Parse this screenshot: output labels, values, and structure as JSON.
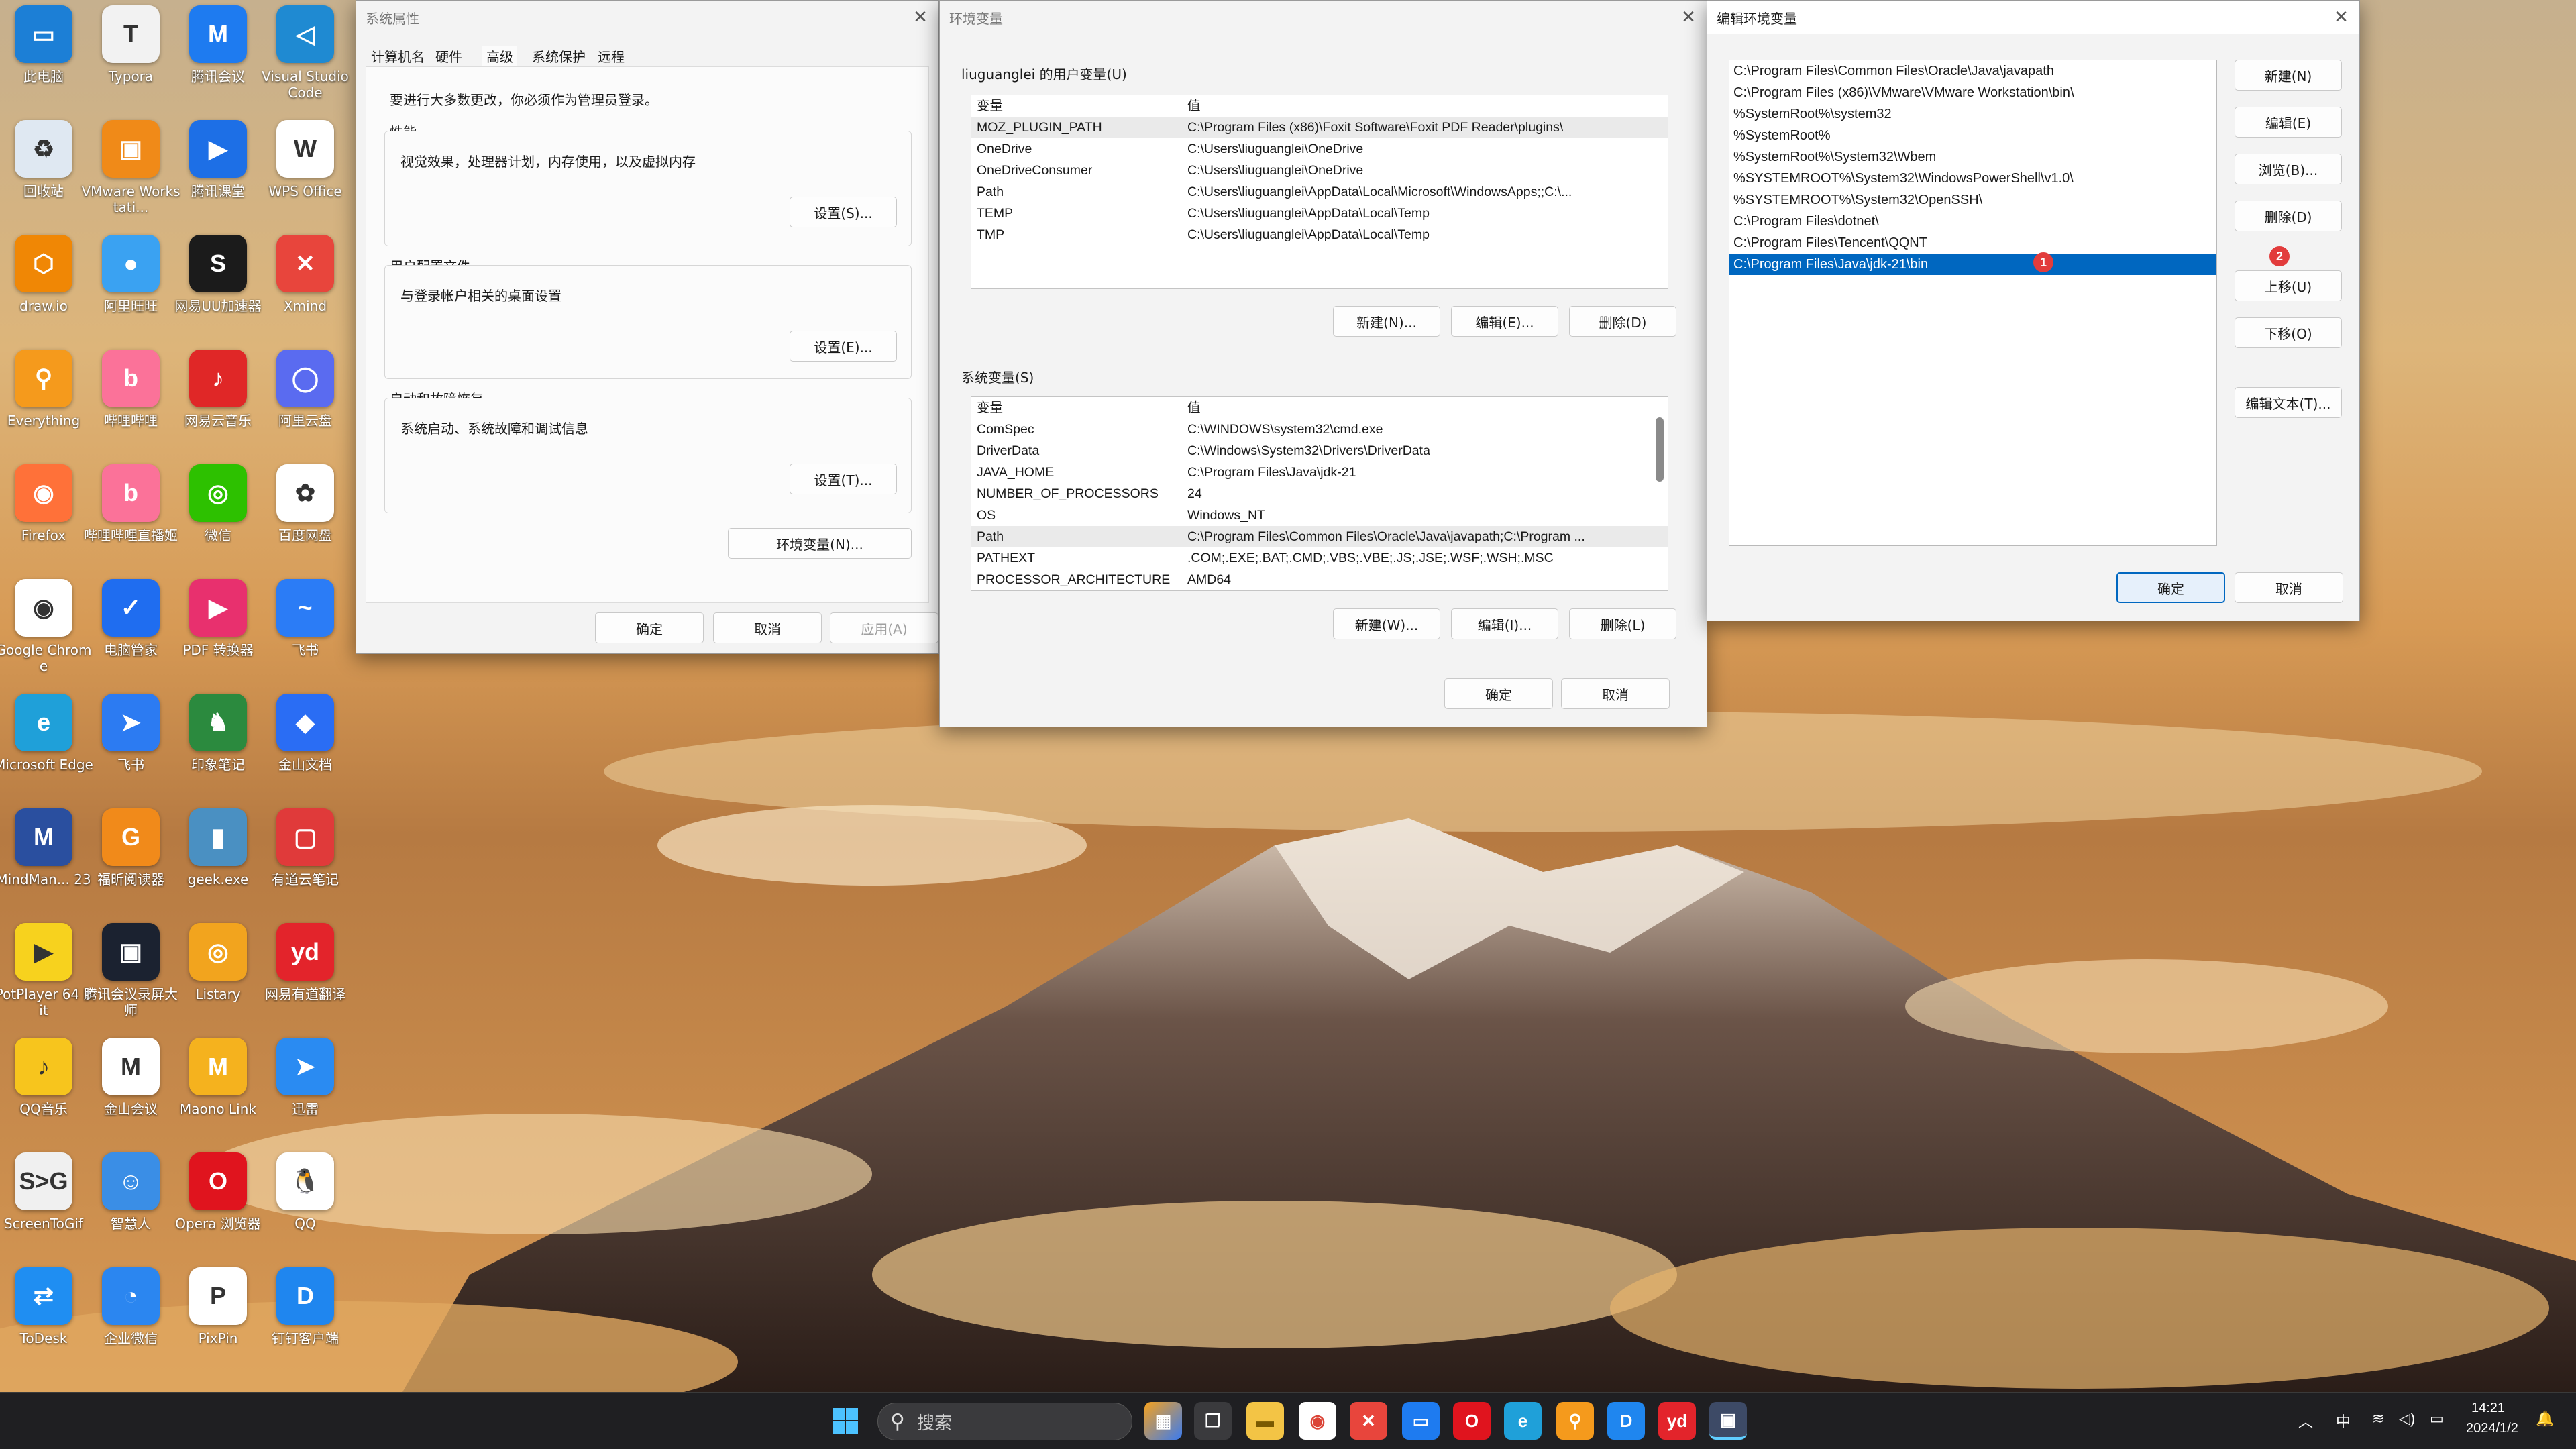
{
  "desktop_icons": [
    {
      "label": "此电脑",
      "icon": "computer-icon",
      "color": "#1c7fd6",
      "glyph": "▭"
    },
    {
      "label": "Typora",
      "icon": "typora-icon",
      "color": "#f2f2f2",
      "glyph": "T"
    },
    {
      "label": "腾讯会议",
      "icon": "tencent-meeting-icon",
      "color": "#1e7bf0",
      "glyph": "M"
    },
    {
      "label": "Visual Studio Code",
      "icon": "vscode-icon",
      "color": "#1f8ad2",
      "glyph": "◁"
    },
    {
      "label": "回收站",
      "icon": "recycle-bin-icon",
      "color": "#dfe8f2",
      "glyph": "♻"
    },
    {
      "label": "VMware Workstati...",
      "icon": "vmware-icon",
      "color": "#f08a18",
      "glyph": "▣"
    },
    {
      "label": "腾讯课堂",
      "icon": "tencent-classroom-icon",
      "color": "#1d6fe6",
      "glyph": "▶"
    },
    {
      "label": "WPS Office",
      "icon": "wps-icon",
      "color": "#ffffff",
      "glyph": "W"
    },
    {
      "label": "draw.io",
      "icon": "drawio-icon",
      "color": "#f08705",
      "glyph": "⬡"
    },
    {
      "label": "阿里旺旺",
      "icon": "aliwangwang-icon",
      "color": "#3aa2f2",
      "glyph": "●"
    },
    {
      "label": "网易UU加速器",
      "icon": "uu-accelerator-icon",
      "color": "#1b1b1b",
      "glyph": "S"
    },
    {
      "label": "Xmind",
      "icon": "xmind-icon",
      "color": "#e8453c",
      "glyph": "✕"
    },
    {
      "label": "Everything",
      "icon": "everything-icon",
      "color": "#f59a1c",
      "glyph": "⚲"
    },
    {
      "label": "哔哩哔哩",
      "icon": "bilibili-icon",
      "color": "#fb7299",
      "glyph": "b"
    },
    {
      "label": "网易云音乐",
      "icon": "netease-music-icon",
      "color": "#e02727",
      "glyph": "♪"
    },
    {
      "label": "阿里云盘",
      "icon": "aliyun-drive-icon",
      "color": "#5a6bf0",
      "glyph": "◯"
    },
    {
      "label": "Firefox",
      "icon": "firefox-icon",
      "color": "#ff7139",
      "glyph": "◉"
    },
    {
      "label": "哔哩哔哩直播姬",
      "icon": "bilibili-live-icon",
      "color": "#fb7299",
      "glyph": "b"
    },
    {
      "label": "微信",
      "icon": "wechat-icon",
      "color": "#2dc100",
      "glyph": "◎"
    },
    {
      "label": "百度网盘",
      "icon": "baidu-netdisk-icon",
      "color": "#ffffff",
      "glyph": "✿"
    },
    {
      "label": "Google Chrome",
      "icon": "chrome-icon",
      "color": "#ffffff",
      "glyph": "◉"
    },
    {
      "label": "电脑管家",
      "icon": "pc-manager-icon",
      "color": "#1f6df0",
      "glyph": "✓"
    },
    {
      "label": "PDF 转换器",
      "icon": "pdf-converter-icon",
      "color": "#e8306e",
      "glyph": "▶"
    },
    {
      "label": "飞书",
      "icon": "feishu-icon",
      "color": "#2b7cf6",
      "glyph": "~"
    },
    {
      "label": "Microsoft Edge",
      "icon": "edge-icon",
      "color": "#1fa0d9",
      "glyph": "e"
    },
    {
      "label": "飞书",
      "icon": "feishu-bird-icon",
      "color": "#2c7bf2",
      "glyph": "➤"
    },
    {
      "label": "印象笔记",
      "icon": "evernote-icon",
      "color": "#2b8a3e",
      "glyph": "♞"
    },
    {
      "label": "金山文档",
      "icon": "kdocs-icon",
      "color": "#2a6df4",
      "glyph": "◆"
    },
    {
      "label": "MindMan... 23",
      "icon": "mindmanager-icon",
      "color": "#2a4f9f",
      "glyph": "M"
    },
    {
      "label": "福昕阅读器",
      "icon": "foxit-icon",
      "color": "#f18a1a",
      "glyph": "G"
    },
    {
      "label": "geek.exe",
      "icon": "geek-uninstaller-icon",
      "color": "#4a90c2",
      "glyph": "▮"
    },
    {
      "label": "有道云笔记",
      "icon": "youdao-note-icon",
      "color": "#e03a3a",
      "glyph": "▢"
    },
    {
      "label": "PotPlayer 64 bit",
      "icon": "potplayer-icon",
      "color": "#f7d21e",
      "glyph": "▶"
    },
    {
      "label": "腾讯会议录屏大师",
      "icon": "screen-recorder-icon",
      "color": "#1b2230",
      "glyph": "▣"
    },
    {
      "label": "Listary",
      "icon": "listary-icon",
      "color": "#f2a41e",
      "glyph": "◎"
    },
    {
      "label": "网易有道翻译",
      "icon": "youdao-translate-icon",
      "color": "#e3242b",
      "glyph": "yd"
    },
    {
      "label": "QQ音乐",
      "icon": "qq-music-icon",
      "color": "#f7c51d",
      "glyph": "♪"
    },
    {
      "label": "金山会议",
      "icon": "kmeeting-icon",
      "color": "#ffffff",
      "glyph": "M"
    },
    {
      "label": "Maono Link",
      "icon": "maono-link-icon",
      "color": "#f5b21e",
      "glyph": "M"
    },
    {
      "label": "迅雷",
      "icon": "xunlei-icon",
      "color": "#2a8bf2",
      "glyph": "➤"
    },
    {
      "label": "ScreenToGif",
      "icon": "screentogif-icon",
      "color": "#f0f0f0",
      "glyph": "S>G"
    },
    {
      "label": "智慧人",
      "icon": "qq-robot-icon",
      "color": "#3a8ee6",
      "glyph": "☺"
    },
    {
      "label": "Opera 浏览器",
      "icon": "opera-icon",
      "color": "#e0141e",
      "glyph": "O"
    },
    {
      "label": "QQ",
      "icon": "qq-icon",
      "color": "#ffffff",
      "glyph": "🐧"
    },
    {
      "label": "ToDesk",
      "icon": "todesk-icon",
      "color": "#1f8ef2",
      "glyph": "⇄"
    },
    {
      "label": "企业微信",
      "icon": "wecom-icon",
      "color": "#2b86f0",
      "glyph": "◔"
    },
    {
      "label": "PixPin",
      "icon": "pixpin-icon",
      "color": "#ffffff",
      "glyph": "P"
    },
    {
      "label": "钉钉客户端",
      "icon": "dingtalk-doc-icon",
      "color": "#1f86ef",
      "glyph": "D"
    }
  ],
  "sysprop": {
    "title": "系统属性",
    "tabs": [
      "计算机名",
      "硬件",
      "高级",
      "系统保护",
      "远程"
    ],
    "notice": "要进行大多数更改，你必须作为管理员登录。",
    "perf_title": "性能",
    "perf_desc": "视觉效果，处理器计划，内存使用，以及虚拟内存",
    "perf_btn": "设置(S)...",
    "profile_title": "用户配置文件",
    "profile_desc": "与登录帐户相关的桌面设置",
    "profile_btn": "设置(E)...",
    "startup_title": "启动和故障恢复",
    "startup_desc": "系统启动、系统故障和调试信息",
    "startup_btn": "设置(T)...",
    "env_btn": "环境变量(N)...",
    "ok": "确定",
    "cancel": "取消",
    "apply": "应用(A)"
  },
  "envvars": {
    "title": "环境变量",
    "user_title": "liuguanglei 的用户变量(U)",
    "col_var": "变量",
    "col_val": "值",
    "user_rows": [
      {
        "name": "MOZ_PLUGIN_PATH",
        "value": "C:\\Program Files (x86)\\Foxit Software\\Foxit PDF Reader\\plugins\\"
      },
      {
        "name": "OneDrive",
        "value": "C:\\Users\\liuguanglei\\OneDrive"
      },
      {
        "name": "OneDriveConsumer",
        "value": "C:\\Users\\liuguanglei\\OneDrive"
      },
      {
        "name": "Path",
        "value": "C:\\Users\\liuguanglei\\AppData\\Local\\Microsoft\\WindowsApps;;C:\\..."
      },
      {
        "name": "TEMP",
        "value": "C:\\Users\\liuguanglei\\AppData\\Local\\Temp"
      },
      {
        "name": "TMP",
        "value": "C:\\Users\\liuguanglei\\AppData\\Local\\Temp"
      }
    ],
    "user_new": "新建(N)...",
    "user_edit": "编辑(E)...",
    "user_delete": "删除(D)",
    "sys_title": "系统变量(S)",
    "sys_rows": [
      {
        "name": "ComSpec",
        "value": "C:\\WINDOWS\\system32\\cmd.exe"
      },
      {
        "name": "DriverData",
        "value": "C:\\Windows\\System32\\Drivers\\DriverData"
      },
      {
        "name": "JAVA_HOME",
        "value": "C:\\Program Files\\Java\\jdk-21"
      },
      {
        "name": "NUMBER_OF_PROCESSORS",
        "value": "24"
      },
      {
        "name": "OS",
        "value": "Windows_NT"
      },
      {
        "name": "Path",
        "value": "C:\\Program Files\\Common Files\\Oracle\\Java\\javapath;C:\\Program ..."
      },
      {
        "name": "PATHEXT",
        "value": ".COM;.EXE;.BAT;.CMD;.VBS;.VBE;.JS;.JSE;.WSF;.WSH;.MSC"
      },
      {
        "name": "PROCESSOR_ARCHITECTURE",
        "value": "AMD64"
      }
    ],
    "sys_new": "新建(W)...",
    "sys_edit": "编辑(I)...",
    "sys_delete": "删除(L)",
    "ok": "确定",
    "cancel": "取消"
  },
  "editenv": {
    "title": "编辑环境变量",
    "paths": [
      "C:\\Program Files\\Common Files\\Oracle\\Java\\javapath",
      "C:\\Program Files (x86)\\VMware\\VMware Workstation\\bin\\",
      "%SystemRoot%\\system32",
      "%SystemRoot%",
      "%SystemRoot%\\System32\\Wbem",
      "%SYSTEMROOT%\\System32\\WindowsPowerShell\\v1.0\\",
      "%SYSTEMROOT%\\System32\\OpenSSH\\",
      "C:\\Program Files\\dotnet\\",
      "C:\\Program Files\\Tencent\\QQNT",
      "C:\\Program Files\\Java\\jdk-21\\bin"
    ],
    "badge1": "1",
    "badge2": "2",
    "new_btn": "新建(N)",
    "edit_btn": "编辑(E)",
    "browse_btn": "浏览(B)...",
    "delete_btn": "删除(D)",
    "up_btn": "上移(U)",
    "down_btn": "下移(O)",
    "edit_text_btn": "编辑文本(T)...",
    "ok": "确定",
    "cancel": "取消"
  },
  "taskbar": {
    "search_placeholder": "搜索",
    "ime": "中",
    "time": "14:21",
    "date": "2024/1/2"
  }
}
